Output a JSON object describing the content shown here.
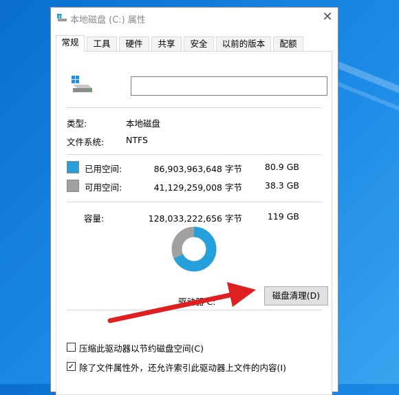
{
  "window": {
    "title": "本地磁盘 (C:) 属性",
    "close": "✕"
  },
  "tabs": [
    {
      "label": "常规"
    },
    {
      "label": "工具"
    },
    {
      "label": "硬件"
    },
    {
      "label": "共享"
    },
    {
      "label": "安全"
    },
    {
      "label": "以前的版本"
    },
    {
      "label": "配额"
    }
  ],
  "drive_name_value": "",
  "type": {
    "label": "类型:",
    "value": "本地磁盘"
  },
  "filesystem": {
    "label": "文件系统:",
    "value": "NTFS"
  },
  "used": {
    "label": "已用空间:",
    "bytes": "86,903,963,648 字节",
    "size": "80.9 GB",
    "color": "#26a0da"
  },
  "free": {
    "label": "可用空间:",
    "bytes": "41,129,259,008 字节",
    "size": "38.3 GB",
    "color": "#a0a0a0"
  },
  "capacity": {
    "label": "容量:",
    "bytes": "128,033,222,656 字节",
    "size": "119 GB"
  },
  "usage_fraction": 0.679,
  "drive_label": "驱动器 C:",
  "cleanup_button": "磁盘清理(D)",
  "compress": {
    "label": "压缩此驱动器以节约磁盘空间(C)",
    "checked": false
  },
  "index": {
    "label": "除了文件属性外，还允许索引此驱动器上文件的内容(I)",
    "checked": true
  },
  "annotation_color": "#e02020"
}
